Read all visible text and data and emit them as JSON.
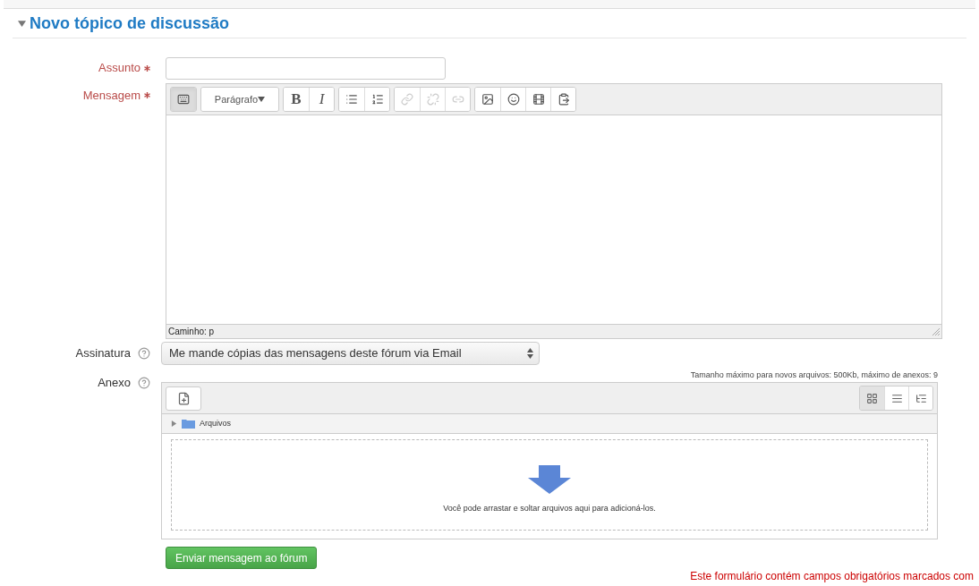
{
  "section": {
    "title": "Novo tópico de discussão",
    "expanded": true
  },
  "subject": {
    "label": "Assunto",
    "required": true
  },
  "message": {
    "label": "Mensagem",
    "required": true,
    "format_select": {
      "value": "Parágrafo"
    },
    "toolbar_groups": [
      [
        {
          "kind": "toggle",
          "pressed": true,
          "disabled": false
        }
      ],
      [
        {
          "kind": "format",
          "pressed": false,
          "disabled": false
        }
      ],
      [
        {
          "kind": "bold",
          "text": "B",
          "pressed": false,
          "disabled": false
        },
        {
          "kind": "italic",
          "text": "I",
          "pressed": false,
          "disabled": false
        }
      ],
      [
        {
          "kind": "bullets",
          "pressed": false,
          "disabled": false
        },
        {
          "kind": "numbers",
          "pressed": false,
          "disabled": false
        }
      ],
      [
        {
          "kind": "link",
          "pressed": false,
          "disabled": true
        },
        {
          "kind": "unlink",
          "pressed": false,
          "disabled": true
        },
        {
          "kind": "anchor",
          "pressed": false,
          "disabled": true
        }
      ],
      [
        {
          "kind": "image",
          "pressed": false,
          "disabled": false
        },
        {
          "kind": "emoticon",
          "pressed": false,
          "disabled": false
        },
        {
          "kind": "media",
          "pressed": false,
          "disabled": false
        },
        {
          "kind": "paste",
          "pressed": false,
          "disabled": false
        }
      ]
    ],
    "path": "Caminho: p"
  },
  "signature": {
    "label": "Assinatura",
    "value": "Me mande cópias das mensagens deste fórum via Email"
  },
  "attachment": {
    "label": "Anexo",
    "limits": "Tamanho máximo para novos arquivos: 500Kb, máximo de anexos: 9",
    "views": [
      {
        "kind": "icons",
        "selected": true
      },
      {
        "kind": "list",
        "selected": false
      },
      {
        "kind": "tree",
        "selected": false
      }
    ],
    "folder": "Arquivos",
    "drop_hint": "Você pode arrastar e soltar arquivos aqui para adicioná-los."
  },
  "submit": "Enviar mensagem ao fórum",
  "required_note": "Este formulário contém campos obrigatórios marcados com"
}
